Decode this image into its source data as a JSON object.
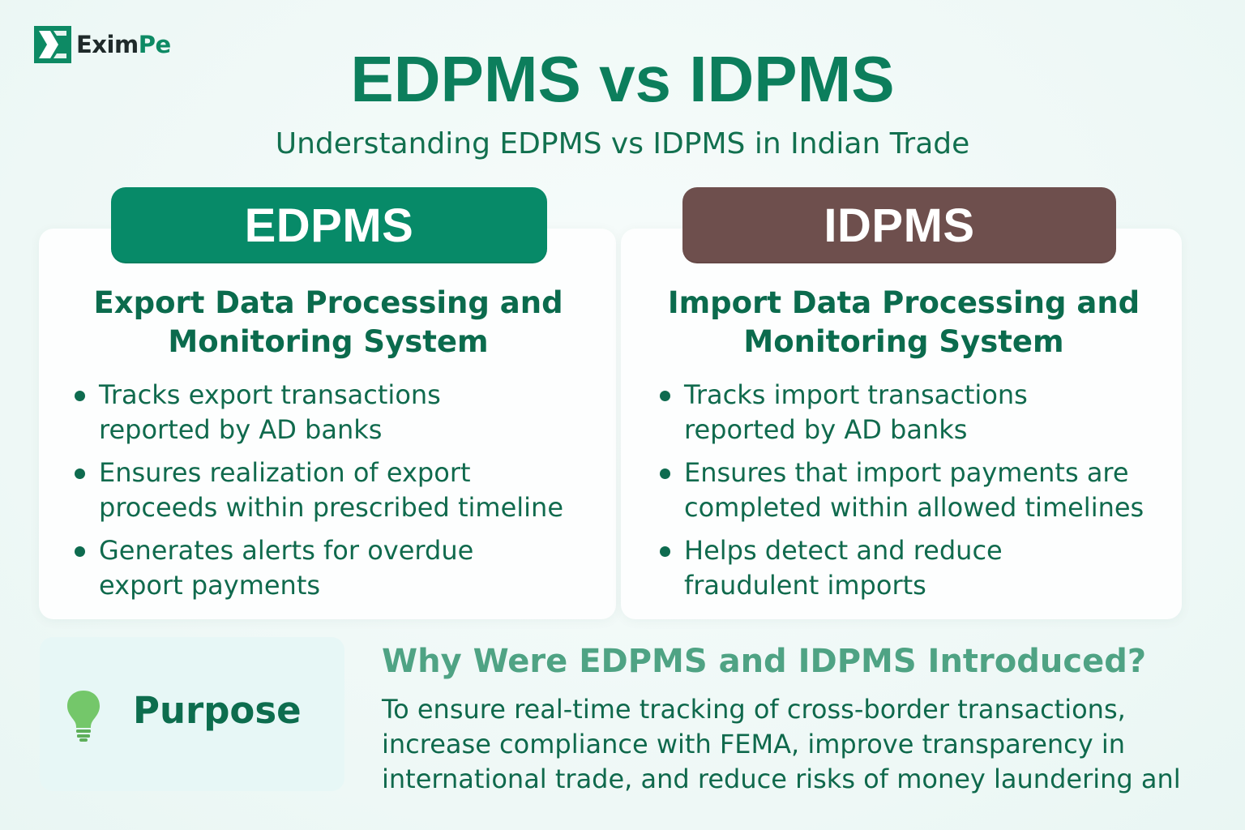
{
  "brand": {
    "name_part1": "Exim",
    "name_part2": "Pe"
  },
  "header": {
    "title": "EDPMS vs IDPMS",
    "subtitle": "Understanding EDPMS vs IDPMS in Indian Trade"
  },
  "edpms": {
    "label": "EDPMS",
    "color": "#078a68",
    "full_name_line1": "Export Data Processing and",
    "full_name_line2": "Monitoring System",
    "points": [
      {
        "line1": "Tracks export transactions",
        "line2": "reported by AD banks"
      },
      {
        "line1": "Ensures realization of export",
        "line2": "proceeds within prescribed timeline"
      },
      {
        "line1": "Generates alerts for overdue",
        "line2": "export payments"
      }
    ]
  },
  "idpms": {
    "label": "IDPMS",
    "color": "#6e4f4d",
    "full_name_line1": "Import Data Processing and",
    "full_name_line2": "Monitoring System",
    "points": [
      {
        "line1": "Tracks import transactions",
        "line2": "reported by AD banks"
      },
      {
        "line1": "Ensures that import payments are",
        "line2": "completed within allowed timelines"
      },
      {
        "line1": "Helps detect and reduce",
        "line2": "fraudulent imports"
      }
    ]
  },
  "purpose": {
    "label": "Purpose",
    "icon": "lightbulb-icon",
    "heading": "Why Were EDPMS and IDPMS Introduced?",
    "body_line1": "To ensure real-time tracking of cross-border transactions,",
    "body_line2": "increase compliance with FEMA, improve transparency in",
    "body_line3": "international trade, and reduce risks of money laundering anl"
  }
}
